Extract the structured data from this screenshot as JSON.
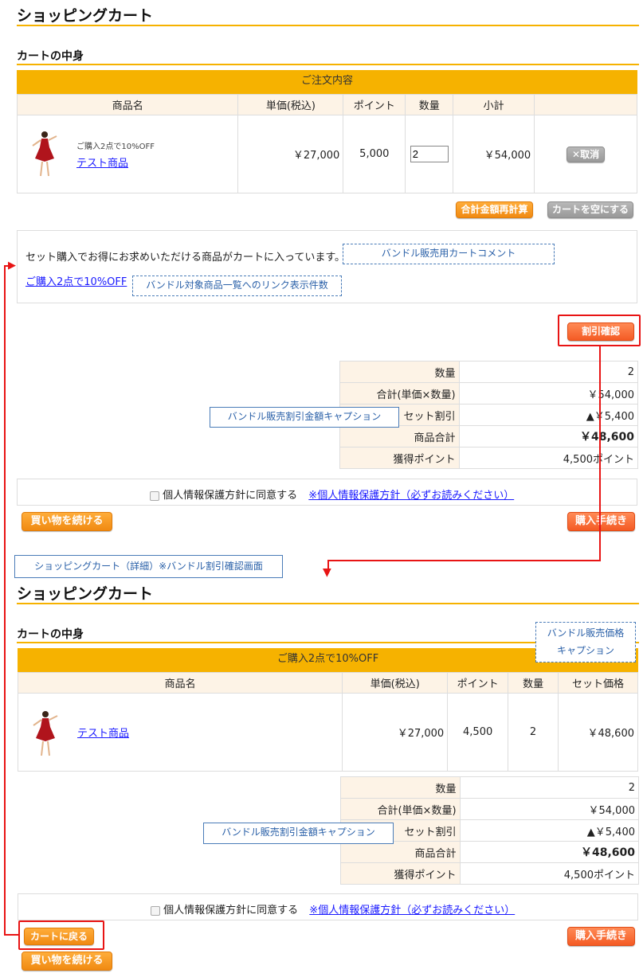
{
  "cart": {
    "title": "ショッピングカート",
    "section_title": "カートの中身",
    "order_header": "ご注文内容",
    "columns": [
      "商品名",
      "単価(税込)",
      "ポイント",
      "数量",
      "小計"
    ],
    "item": {
      "promo": "ご購入2点で10%OFF",
      "name": "テスト商品",
      "price": "￥27,000",
      "points": "5,000",
      "qty": "2",
      "subtotal": "￥54,000",
      "remove_label": "取消"
    },
    "recalc_button": "合計金額再計算",
    "empty_button": "カートを空にする",
    "bundle_message": "セット購入でお得にお求めいただける商品がカートに入っています。",
    "bundle_link": "ご購入2点で10%OFF",
    "note_cart_comment": "バンドル販売用カートコメント",
    "note_link_count": "バンドル対象商品一覧へのリンク表示件数",
    "discount_button": "割引確認",
    "summary": [
      {
        "label": "数量",
        "value": "2"
      },
      {
        "label": "合計(単価×数量)",
        "value": "￥54,000"
      },
      {
        "label": "セット割引",
        "value": "▲￥5,400"
      },
      {
        "label": "商品合計",
        "value": "￥48,600"
      },
      {
        "label": "獲得ポイント",
        "value": "4,500ポイント"
      }
    ],
    "note_discount_caption": "バンドル販売割引金額キャプション",
    "privacy_label": "個人情報保護方針に同意する",
    "privacy_link": "※個人情報保護方針（必ずお読みください）",
    "continue_button": "買い物を続ける",
    "checkout_button": "購入手続き"
  },
  "detail_caption": "ショッピングカート（詳細）※バンドル割引確認画面",
  "detail": {
    "title": "ショッピングカート",
    "section_title": "カートの中身",
    "note_price_caption_1": "バンドル販売価格",
    "note_price_caption_2": "キャプション",
    "bundle_header": "ご購入2点で10%OFF",
    "columns": [
      "商品名",
      "単価(税込)",
      "ポイント",
      "数量",
      "セット価格"
    ],
    "item": {
      "name": "テスト商品",
      "price": "￥27,000",
      "points": "4,500",
      "qty": "2",
      "set_price": "￥48,600"
    },
    "summary": [
      {
        "label": "数量",
        "value": "2"
      },
      {
        "label": "合計(単価×数量)",
        "value": "￥54,000"
      },
      {
        "label": "セット割引",
        "value": "▲￥5,400"
      },
      {
        "label": "商品合計",
        "value": "￥48,600"
      },
      {
        "label": "獲得ポイント",
        "value": "4,500ポイント"
      }
    ],
    "note_discount_caption": "バンドル販売割引金額キャプション",
    "privacy_label": "個人情報保護方針に同意する",
    "privacy_link": "※個人情報保護方針（必ずお読みください）",
    "back_button": "カートに戻る",
    "checkout_button": "購入手続き",
    "continue_button": "買い物を続ける"
  },
  "colors": {
    "accent": "#f6b200",
    "header_bg": "#fdf3e6",
    "annotation": "#e81414",
    "note": "#4a7cb8"
  }
}
